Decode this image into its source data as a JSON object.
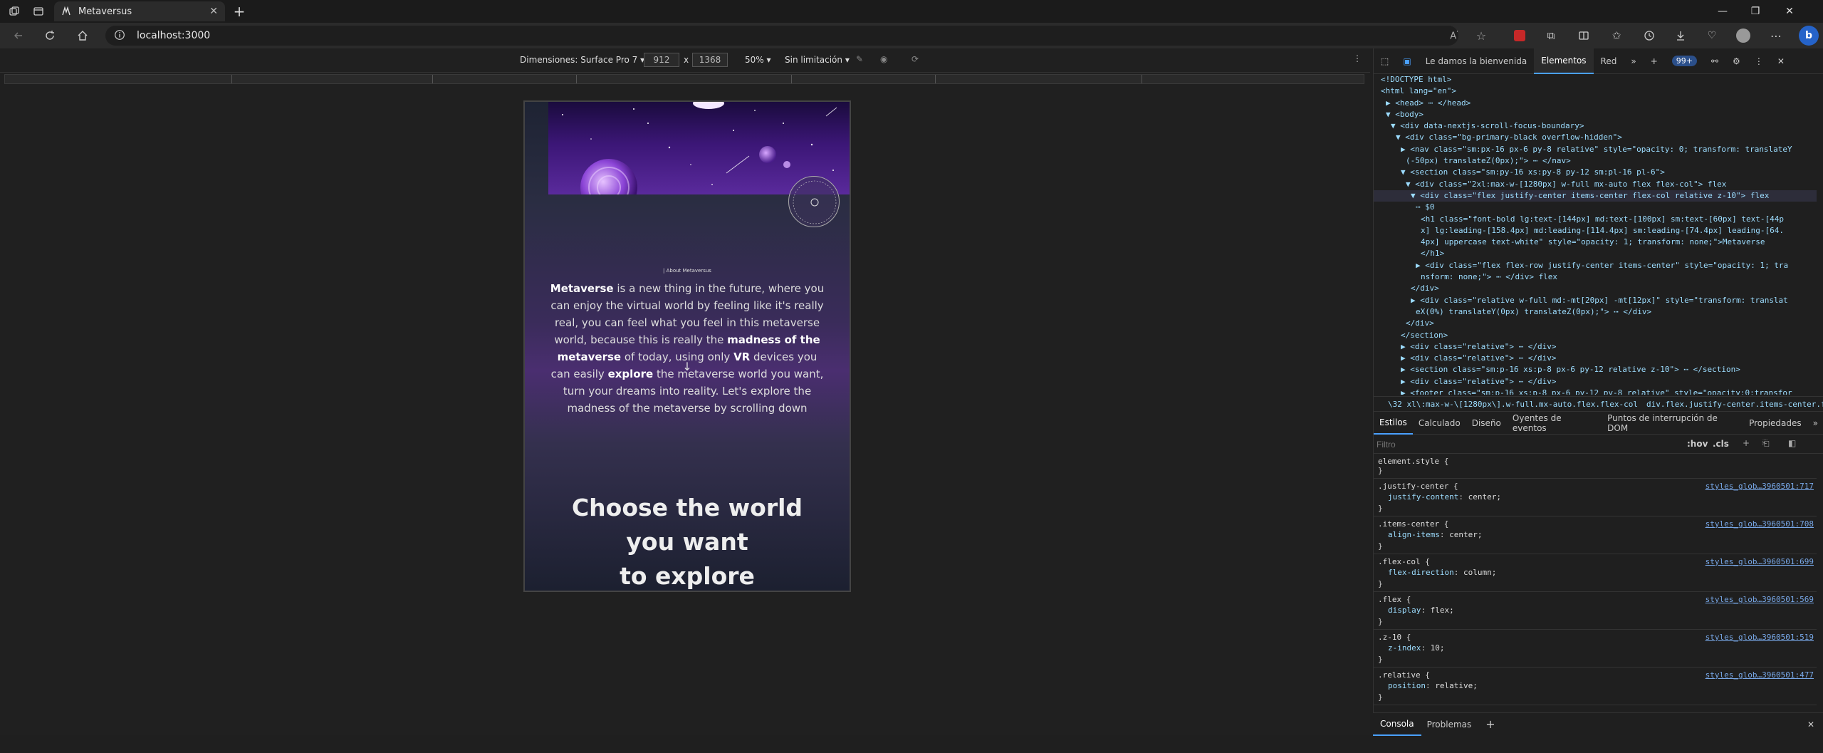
{
  "browser": {
    "tab_title": "Metaversus",
    "url": "localhost:3000"
  },
  "device_toolbar": {
    "dimensions_label": "Dimensiones: Surface Pro 7",
    "width": "912",
    "height": "1368",
    "times": "x",
    "zoom": "50%",
    "throttle": "Sin limitación"
  },
  "page": {
    "about_label": "| About Metaversus",
    "about_segments": [
      {
        "text": "Metaverse",
        "bold": true
      },
      {
        "text": " is a new thing in the future, where you can enjoy the virtual world by feeling like it's really real, you can feel what you feel in this metaverse world, because this is really the ",
        "bold": false
      },
      {
        "text": "madness of the metaverse",
        "bold": true
      },
      {
        "text": " of today, using only ",
        "bold": false
      },
      {
        "text": "VR",
        "bold": true
      },
      {
        "text": " devices you can easily ",
        "bold": false
      },
      {
        "text": "explore",
        "bold": true
      },
      {
        "text": " the metaverse world you want, turn your dreams into reality. Let's explore the madness of the metaverse by scrolling down",
        "bold": false
      }
    ],
    "arrow": "↓",
    "choose_line1": "Choose the world you want",
    "choose_line2": "to explore"
  },
  "devtools": {
    "tabs": [
      "Le damos la bienvenida",
      "Elementos",
      "Red"
    ],
    "active_tab": "Elementos",
    "issues_badge": "99+",
    "dom_lines": [
      {
        "indent": 0,
        "html": "<!DOCTYPE html>"
      },
      {
        "indent": 0,
        "html": "<html lang=\"en\">"
      },
      {
        "indent": 1,
        "html": "▶ <head> ⋯ </head>"
      },
      {
        "indent": 1,
        "html": "▼ <body>"
      },
      {
        "indent": 2,
        "html": "▼ <div data-nextjs-scroll-focus-boundary>"
      },
      {
        "indent": 3,
        "html": "▼ <div class=\"bg-primary-black overflow-hidden\">"
      },
      {
        "indent": 4,
        "html": "▶ <nav class=\"sm:px-16 px-6 py-8 relative\" style=\"opacity: 0; transform: translateY"
      },
      {
        "indent": 5,
        "html": "(-50px) translateZ(0px);\"> ⋯ </nav>"
      },
      {
        "indent": 4,
        "html": "▼ <section class=\"sm:py-16 xs:py-8 py-12 sm:pl-16 pl-6\">"
      },
      {
        "indent": 5,
        "html": "▼ <div class=\"2xl:max-w-[1280px] w-full mx-auto flex flex-col\"> flex"
      },
      {
        "indent": 6,
        "html": "▼ <div class=\"flex justify-center items-center flex-col relative z-10\"> flex",
        "selected": true
      },
      {
        "indent": 7,
        "html": "⋯ $0"
      },
      {
        "indent": 8,
        "html": "<h1 class=\"font-bold lg:text-[144px] md:text-[100px] sm:text-[60px] text-[44p"
      },
      {
        "indent": 8,
        "html": "x] lg:leading-[158.4px] md:leading-[114.4px] sm:leading-[74.4px] leading-[64."
      },
      {
        "indent": 8,
        "html": "4px] uppercase text-white\" style=\"opacity: 1; transform: none;\">Metaverse"
      },
      {
        "indent": 8,
        "html": "</h1>"
      },
      {
        "indent": 7,
        "html": "▶ <div class=\"flex flex-row justify-center items-center\" style=\"opacity: 1; tra"
      },
      {
        "indent": 8,
        "html": "nsform: none;\"> ⋯ </div> flex"
      },
      {
        "indent": 6,
        "html": "</div>"
      },
      {
        "indent": 6,
        "html": "▶ <div class=\"relative w-full md:-mt[20px] -mt[12px]\" style=\"transform: translat"
      },
      {
        "indent": 7,
        "html": "eX(0%) translateY(0px) translateZ(0px);\"> ⋯ </div>"
      },
      {
        "indent": 5,
        "html": "</div>"
      },
      {
        "indent": 4,
        "html": "</section>"
      },
      {
        "indent": 4,
        "html": "▶ <div class=\"relative\"> ⋯ </div>"
      },
      {
        "indent": 4,
        "html": "▶ <div class=\"relative\"> ⋯ </div>"
      },
      {
        "indent": 4,
        "html": "▶ <section class=\"sm:p-16 xs:p-8 px-6 py-12 relative z-10\"> ⋯ </section>"
      },
      {
        "indent": 4,
        "html": "▶ <div class=\"relative\"> ⋯ </div>"
      },
      {
        "indent": 4,
        "html": "▶ <footer class=\"sm:p-16 xs:p-8 px-6 py-12 py-8 relative\" style=\"opacity:0;transfor"
      }
    ],
    "breadcrumbs": [
      "\\32 xl\\:max-w-\\[1280px\\].w-full.mx-auto.flex.flex-col",
      "div.flex.justify-center.items-center.flex-col.relative.z-10"
    ],
    "style_tabs": [
      "Estilos",
      "Calculado",
      "Diseño",
      "Oyentes de eventos",
      "Puntos de interrupción de DOM",
      "Propiedades"
    ],
    "filter_placeholder": "Filtro",
    "hov": ":hov",
    "cls": ".cls",
    "rules": [
      {
        "selector": "element.style {",
        "source": "",
        "decls": []
      },
      {
        "selector": ".justify-center {",
        "source": "styles_glob…3960501:717",
        "decls": [
          {
            "prop": "justify-content",
            "val": "center;"
          }
        ]
      },
      {
        "selector": ".items-center {",
        "source": "styles_glob…3960501:708",
        "decls": [
          {
            "prop": "align-items",
            "val": "center;"
          }
        ]
      },
      {
        "selector": ".flex-col {",
        "source": "styles_glob…3960501:699",
        "decls": [
          {
            "prop": "flex-direction",
            "val": "column;"
          }
        ]
      },
      {
        "selector": ".flex {",
        "source": "styles_glob…3960501:569",
        "decls": [
          {
            "prop": "display",
            "val": "flex;"
          }
        ]
      },
      {
        "selector": ".z-10 {",
        "source": "styles_glob…3960501:519",
        "decls": [
          {
            "prop": "z-index",
            "val": "10;"
          }
        ]
      },
      {
        "selector": ".relative {",
        "source": "styles_glob…3960501:477",
        "decls": [
          {
            "prop": "position",
            "val": "relative;"
          }
        ]
      }
    ],
    "console_tabs": [
      "Consola",
      "Problemas"
    ]
  }
}
